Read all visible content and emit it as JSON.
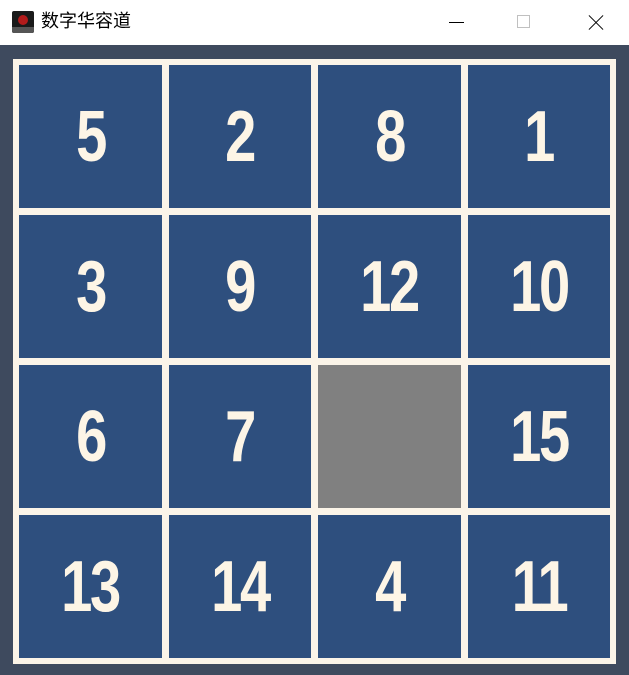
{
  "window": {
    "title": "数字华容道",
    "icon": "app-icon"
  },
  "board": {
    "rows": 4,
    "cols": 4,
    "tiles": [
      {
        "label": "5",
        "empty": false
      },
      {
        "label": "2",
        "empty": false
      },
      {
        "label": "8",
        "empty": false
      },
      {
        "label": "1",
        "empty": false
      },
      {
        "label": "3",
        "empty": false
      },
      {
        "label": "9",
        "empty": false
      },
      {
        "label": "12",
        "empty": false
      },
      {
        "label": "10",
        "empty": false
      },
      {
        "label": "6",
        "empty": false
      },
      {
        "label": "7",
        "empty": false
      },
      {
        "label": "",
        "empty": true
      },
      {
        "label": "15",
        "empty": false
      },
      {
        "label": "13",
        "empty": false
      },
      {
        "label": "14",
        "empty": false
      },
      {
        "label": "4",
        "empty": false
      },
      {
        "label": "11",
        "empty": false
      }
    ]
  },
  "colors": {
    "tile": "#2e4f7e",
    "empty_tile": "#808080",
    "grid_lines": "#fbf4e8",
    "background": "#3e4a5e",
    "digits": "#fdf5e6"
  }
}
